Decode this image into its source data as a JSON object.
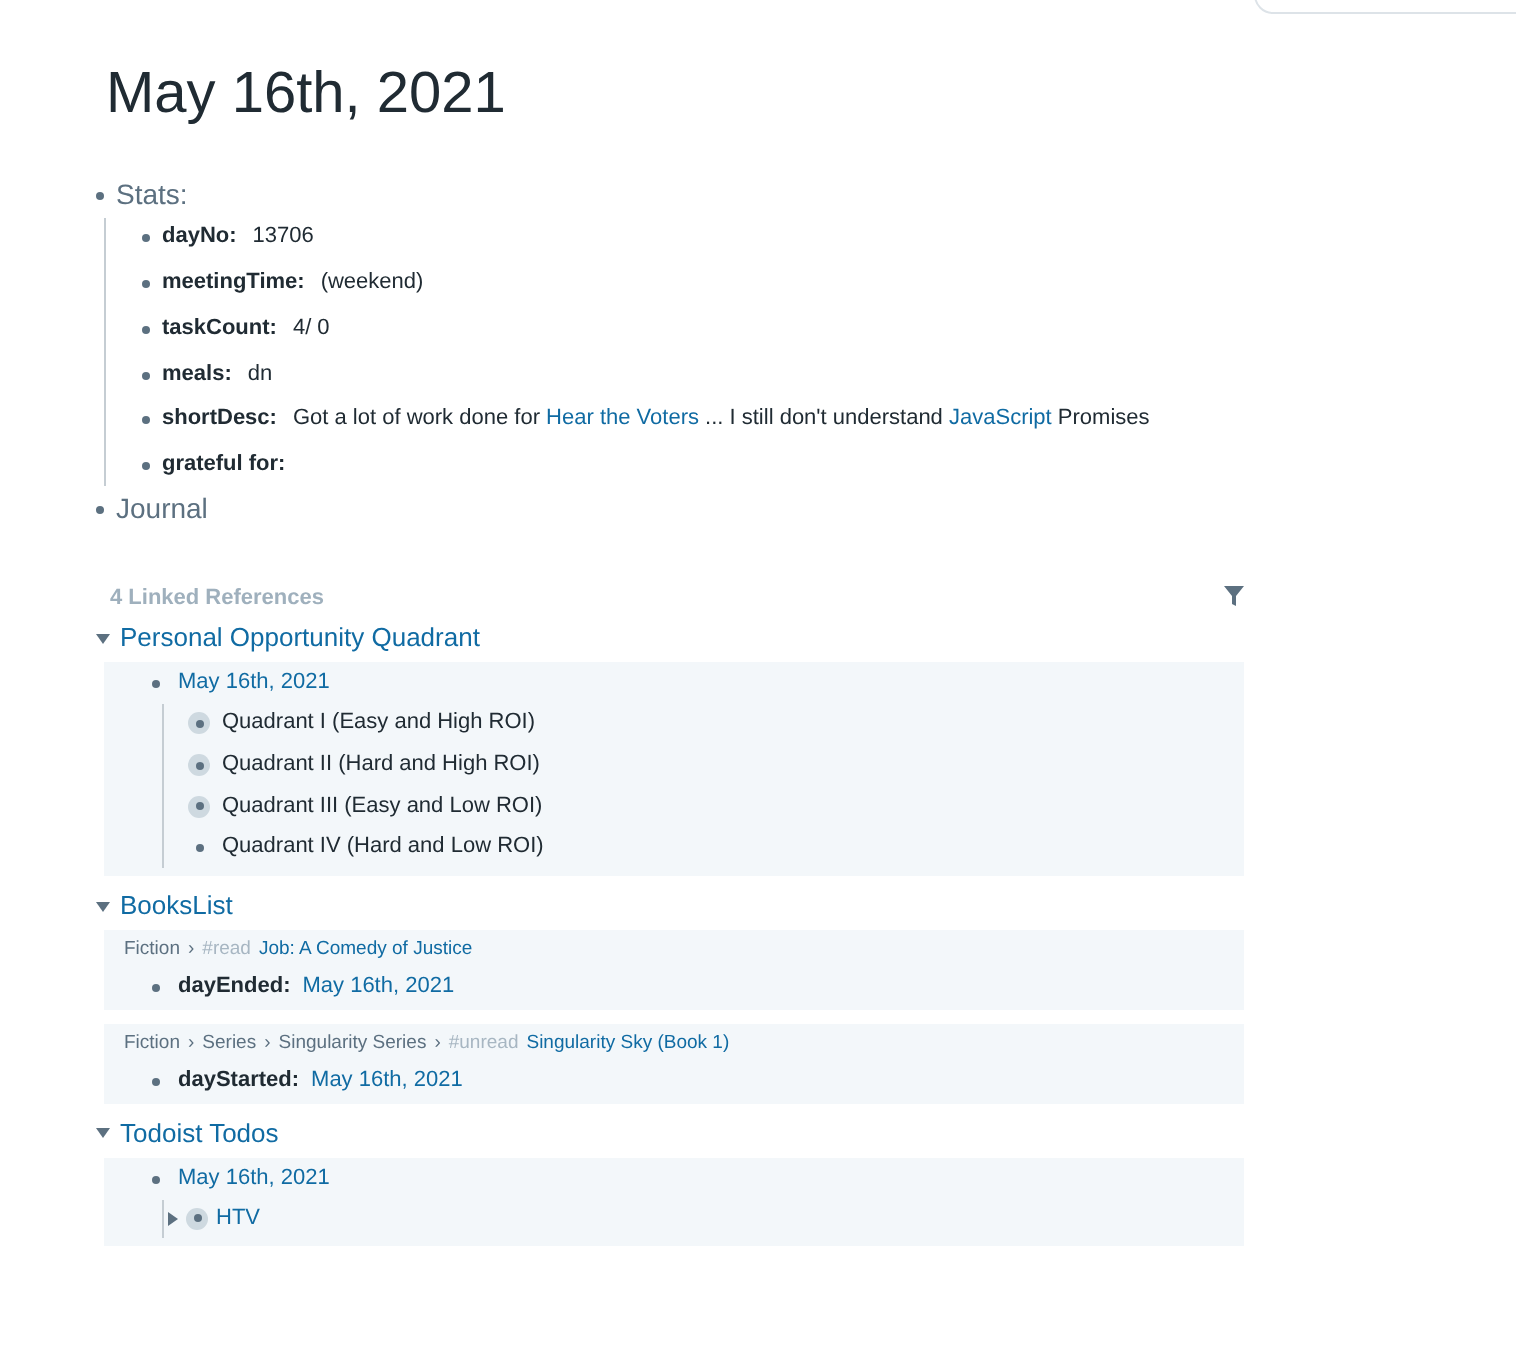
{
  "page_title": "May 16th, 2021",
  "blocks": [
    {
      "text": "Stats:",
      "children": [
        {
          "label": "dayNo:",
          "parts": [
            {
              "kind": "text",
              "text": "13706"
            }
          ]
        },
        {
          "label": "meetingTime:",
          "parts": [
            {
              "kind": "text",
              "text": "(weekend)"
            }
          ]
        },
        {
          "label": "taskCount:",
          "parts": [
            {
              "kind": "text",
              "text": "4/ 0"
            }
          ]
        },
        {
          "label": "meals:",
          "parts": [
            {
              "kind": "text",
              "text": "dn"
            }
          ]
        },
        {
          "label": "shortDesc:",
          "parts": [
            {
              "kind": "text",
              "text": "Got a lot of work done for "
            },
            {
              "kind": "link",
              "text": "Hear the Voters"
            },
            {
              "kind": "text",
              "text": " ... I still don't understand "
            },
            {
              "kind": "link",
              "text": "JavaScript"
            },
            {
              "kind": "text",
              "text": " Promises"
            }
          ]
        },
        {
          "label": "grateful for:"
        }
      ]
    },
    {
      "text": "Journal"
    }
  ],
  "linked_references": {
    "heading": "4 Linked References",
    "groups": [
      {
        "title": "Personal Opportunity Quadrant",
        "expanded": true,
        "refs": [
          {
            "item": {
              "link": "May 16th, 2021",
              "collapsed": false,
              "children": [
                {
                  "text": "Quadrant I (Easy and High ROI)",
                  "collapsed": true,
                  "is_link": false
                },
                {
                  "text": "Quadrant II (Hard and High ROI)",
                  "collapsed": true,
                  "is_link": false
                },
                {
                  "text": "Quadrant III (Easy and Low ROI)",
                  "collapsed": true,
                  "is_link": false
                },
                {
                  "text": "Quadrant IV (Hard and Low ROI)",
                  "collapsed": false,
                  "is_link": false
                }
              ]
            }
          }
        ]
      },
      {
        "title": "BooksList",
        "expanded": true,
        "refs": [
          {
            "breadcrumb": [
              {
                "kind": "crumb",
                "text": "Fiction"
              },
              {
                "kind": "sep",
                "text": "›"
              },
              {
                "kind": "tag",
                "text": "#read"
              },
              {
                "kind": "link",
                "text": "Job: A Comedy of Justice"
              }
            ],
            "item": {
              "label": "dayEnded:",
              "link": "May 16th, 2021",
              "collapsed": false
            }
          },
          {
            "breadcrumb": [
              {
                "kind": "crumb",
                "text": "Fiction"
              },
              {
                "kind": "sep",
                "text": "›"
              },
              {
                "kind": "crumb",
                "text": "Series"
              },
              {
                "kind": "sep",
                "text": "›"
              },
              {
                "kind": "crumb",
                "text": "Singularity Series"
              },
              {
                "kind": "sep",
                "text": "›"
              },
              {
                "kind": "tag",
                "text": "#unread"
              },
              {
                "kind": "link",
                "text": "Singularity Sky (Book 1)"
              }
            ],
            "item": {
              "label": "dayStarted:",
              "link": "May 16th, 2021",
              "collapsed": false
            }
          }
        ]
      },
      {
        "title": "Todoist Todos",
        "expanded": true,
        "refs": [
          {
            "item": {
              "link": "May 16th, 2021",
              "collapsed": false,
              "children": [
                {
                  "text": "HTV",
                  "collapsed": true,
                  "is_link": true
                }
              ]
            }
          }
        ]
      }
    ]
  }
}
